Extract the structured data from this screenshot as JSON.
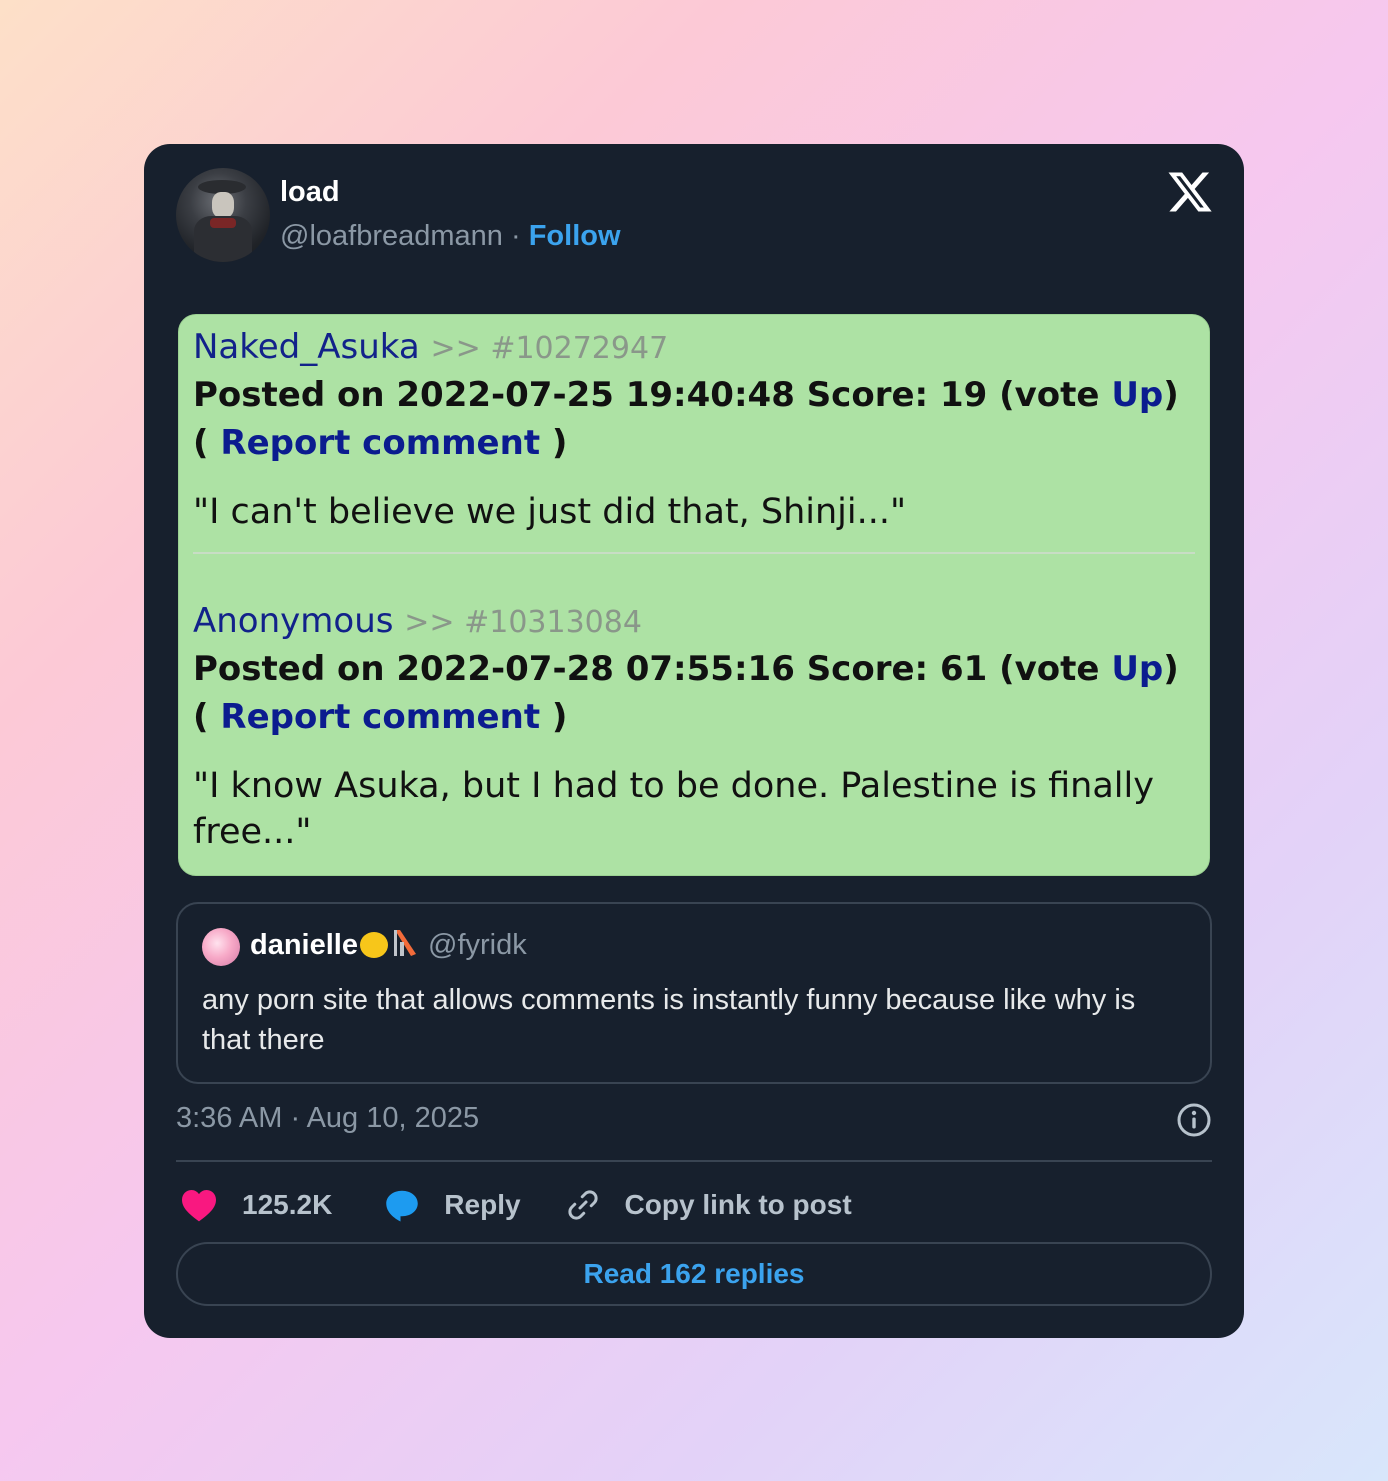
{
  "post": {
    "author_name": "load",
    "author_handle": "@loafbreadmann",
    "separator": "·",
    "follow_label": "Follow"
  },
  "media": {
    "comments": [
      {
        "poster": "Naked_Asuka",
        "post_ref": ">> #10272947",
        "posted_prefix": "Posted on 2022-07-25 19:40:48 Score: 19 (vote",
        "vote_up": "Up",
        "paren_open": ") ( ",
        "report": "Report comment",
        "paren_close": " )",
        "body": "\"I can't believe we just did that, Shinji...\""
      },
      {
        "poster": "Anonymous",
        "post_ref": ">> #10313084",
        "posted_prefix": "Posted on 2022-07-28 07:55:16 Score: 61 (vote",
        "vote_up": "Up",
        "paren_open": ") ( ",
        "report": "Report comment",
        "paren_close": " )",
        "body": "\"I know Asuka, but I had to be done. Palestine is finally free...\""
      }
    ],
    "background_color": "#ade2a4"
  },
  "quote": {
    "name": "danielle",
    "handle": "@fyridk",
    "text": "any porn site that allows comments is instantly funny because like why is that there"
  },
  "timestamp": "3:36 AM · Aug 10, 2025",
  "actions": {
    "likes": "125.2K",
    "reply": "Reply",
    "copy_link": "Copy link to post"
  },
  "read_replies": "Read 162 replies",
  "colors": {
    "card_bg": "#17202d",
    "accent": "#3ba3ee",
    "heart": "#f91880"
  }
}
